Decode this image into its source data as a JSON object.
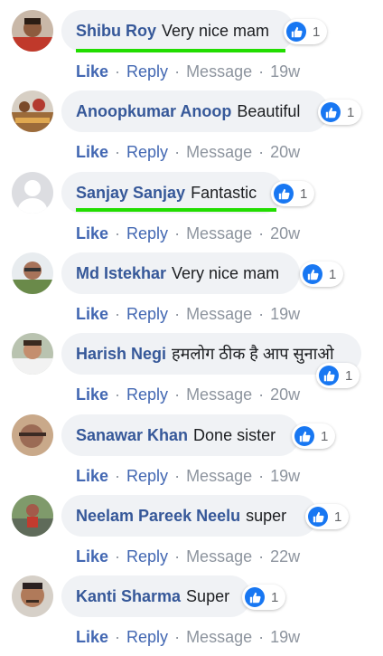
{
  "actions": {
    "like": "Like",
    "reply": "Reply",
    "message": "Message",
    "separator": "·"
  },
  "icons": {
    "reaction": "thumbs-up-icon"
  },
  "colors": {
    "name": "#365899",
    "like_blue": "#1877f2",
    "highlight": "#22dd00",
    "bubble": "#f0f2f5"
  },
  "comments": [
    {
      "name": "Shibu Roy",
      "text": "Very nice mam",
      "reactions": "1",
      "time": "19w"
    },
    {
      "name": "Anoopkumar Anoop",
      "text": "Beautiful",
      "reactions": "1",
      "time": "20w"
    },
    {
      "name": "Sanjay Sanjay",
      "text": "Fantastic",
      "reactions": "1",
      "time": "20w"
    },
    {
      "name": "Md Istekhar",
      "text": "Very nice mam",
      "reactions": "1",
      "time": "19w"
    },
    {
      "name": "Harish Negi",
      "text": "हमलोग ठीक है आप सुनाओ",
      "reactions": "1",
      "time": "20w"
    },
    {
      "name": "Sanawar Khan",
      "text": "Done sister",
      "reactions": "1",
      "time": "19w"
    },
    {
      "name": "Neelam Pareek Neelu",
      "text": "super",
      "reactions": "1",
      "time": "22w"
    },
    {
      "name": "Kanti Sharma",
      "text": "Super",
      "reactions": "1",
      "time": "19w"
    }
  ]
}
